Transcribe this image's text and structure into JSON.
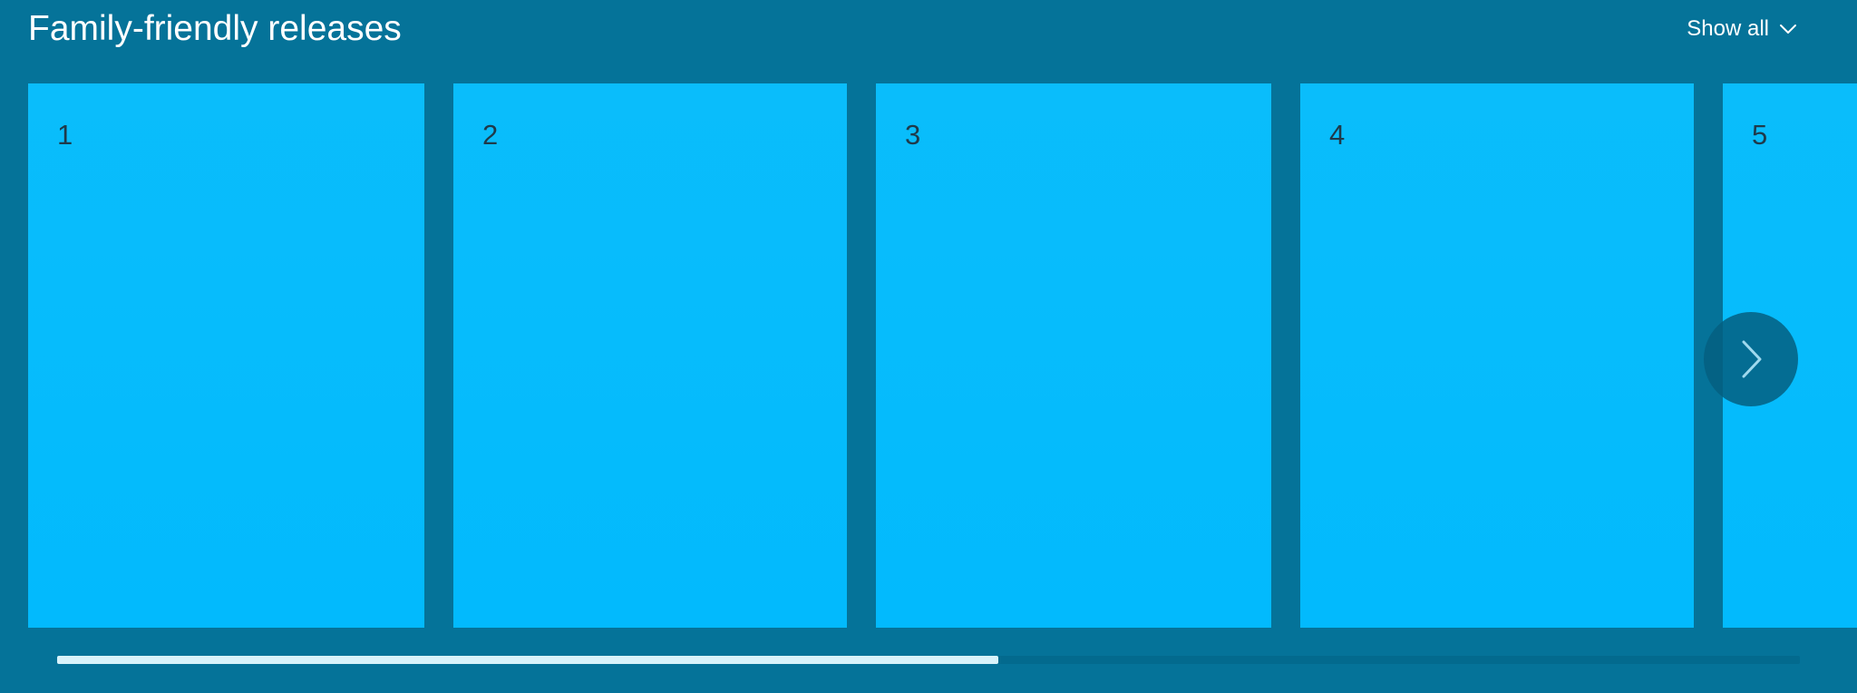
{
  "header": {
    "title": "Family-friendly releases",
    "show_all_label": "Show all",
    "show_all_icon": "chevron-down-icon"
  },
  "carousel": {
    "tiles": [
      {
        "label": "1"
      },
      {
        "label": "2"
      },
      {
        "label": "3"
      },
      {
        "label": "4"
      },
      {
        "label": "5"
      }
    ],
    "next_icon": "chevron-right-icon",
    "scroll_progress": 0.54
  },
  "colors": {
    "background": "#057399",
    "tile": "#02bafd",
    "scroll_thumb": "#d8f3fb",
    "scroll_track": "#036a8e",
    "text": "#ffffff"
  }
}
